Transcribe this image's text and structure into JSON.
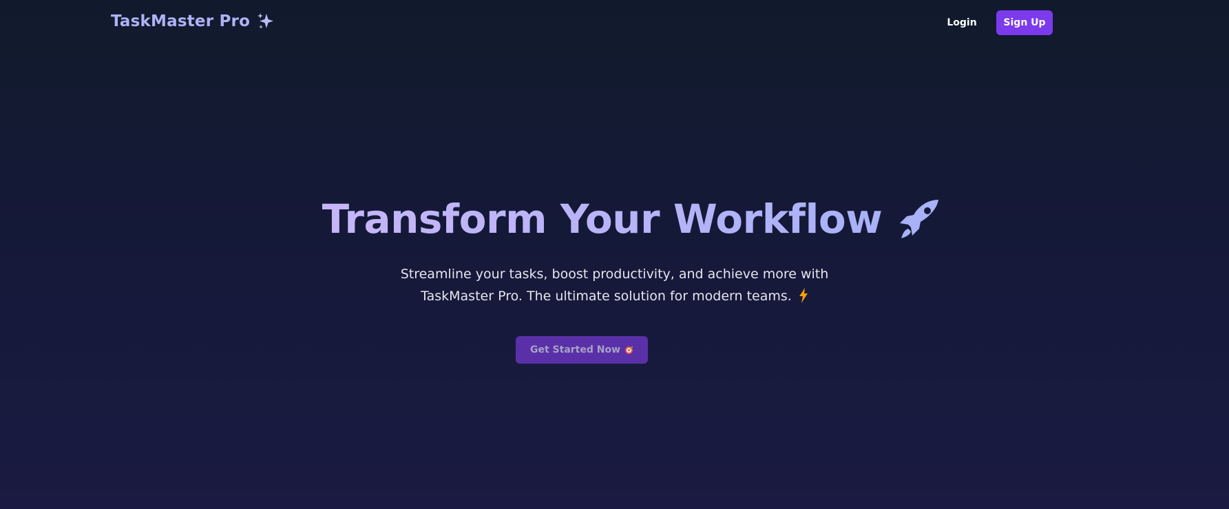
{
  "nav": {
    "brand": "TaskMaster Pro",
    "brand_icon": "sparkles-icon",
    "login_label": "Login",
    "signup_label": "Sign Up"
  },
  "hero": {
    "title": "Transform Your Workflow",
    "title_icon": "rocket-icon",
    "subtitle": "Streamline your tasks, boost productivity, and achieve more with TaskMaster Pro. The ultimate solution for modern teams.",
    "subtitle_icon": "lightning-bolt-icon",
    "cta_label": "Get Started Now",
    "cta_icon": "target-icon"
  },
  "colors": {
    "background_top": "#111a2c",
    "background_bottom": "#1a1a42",
    "brand": "#aeb2f6",
    "accent": "#7c3aed",
    "cta": "#5a30a8",
    "bolt": "#f59e0b"
  }
}
